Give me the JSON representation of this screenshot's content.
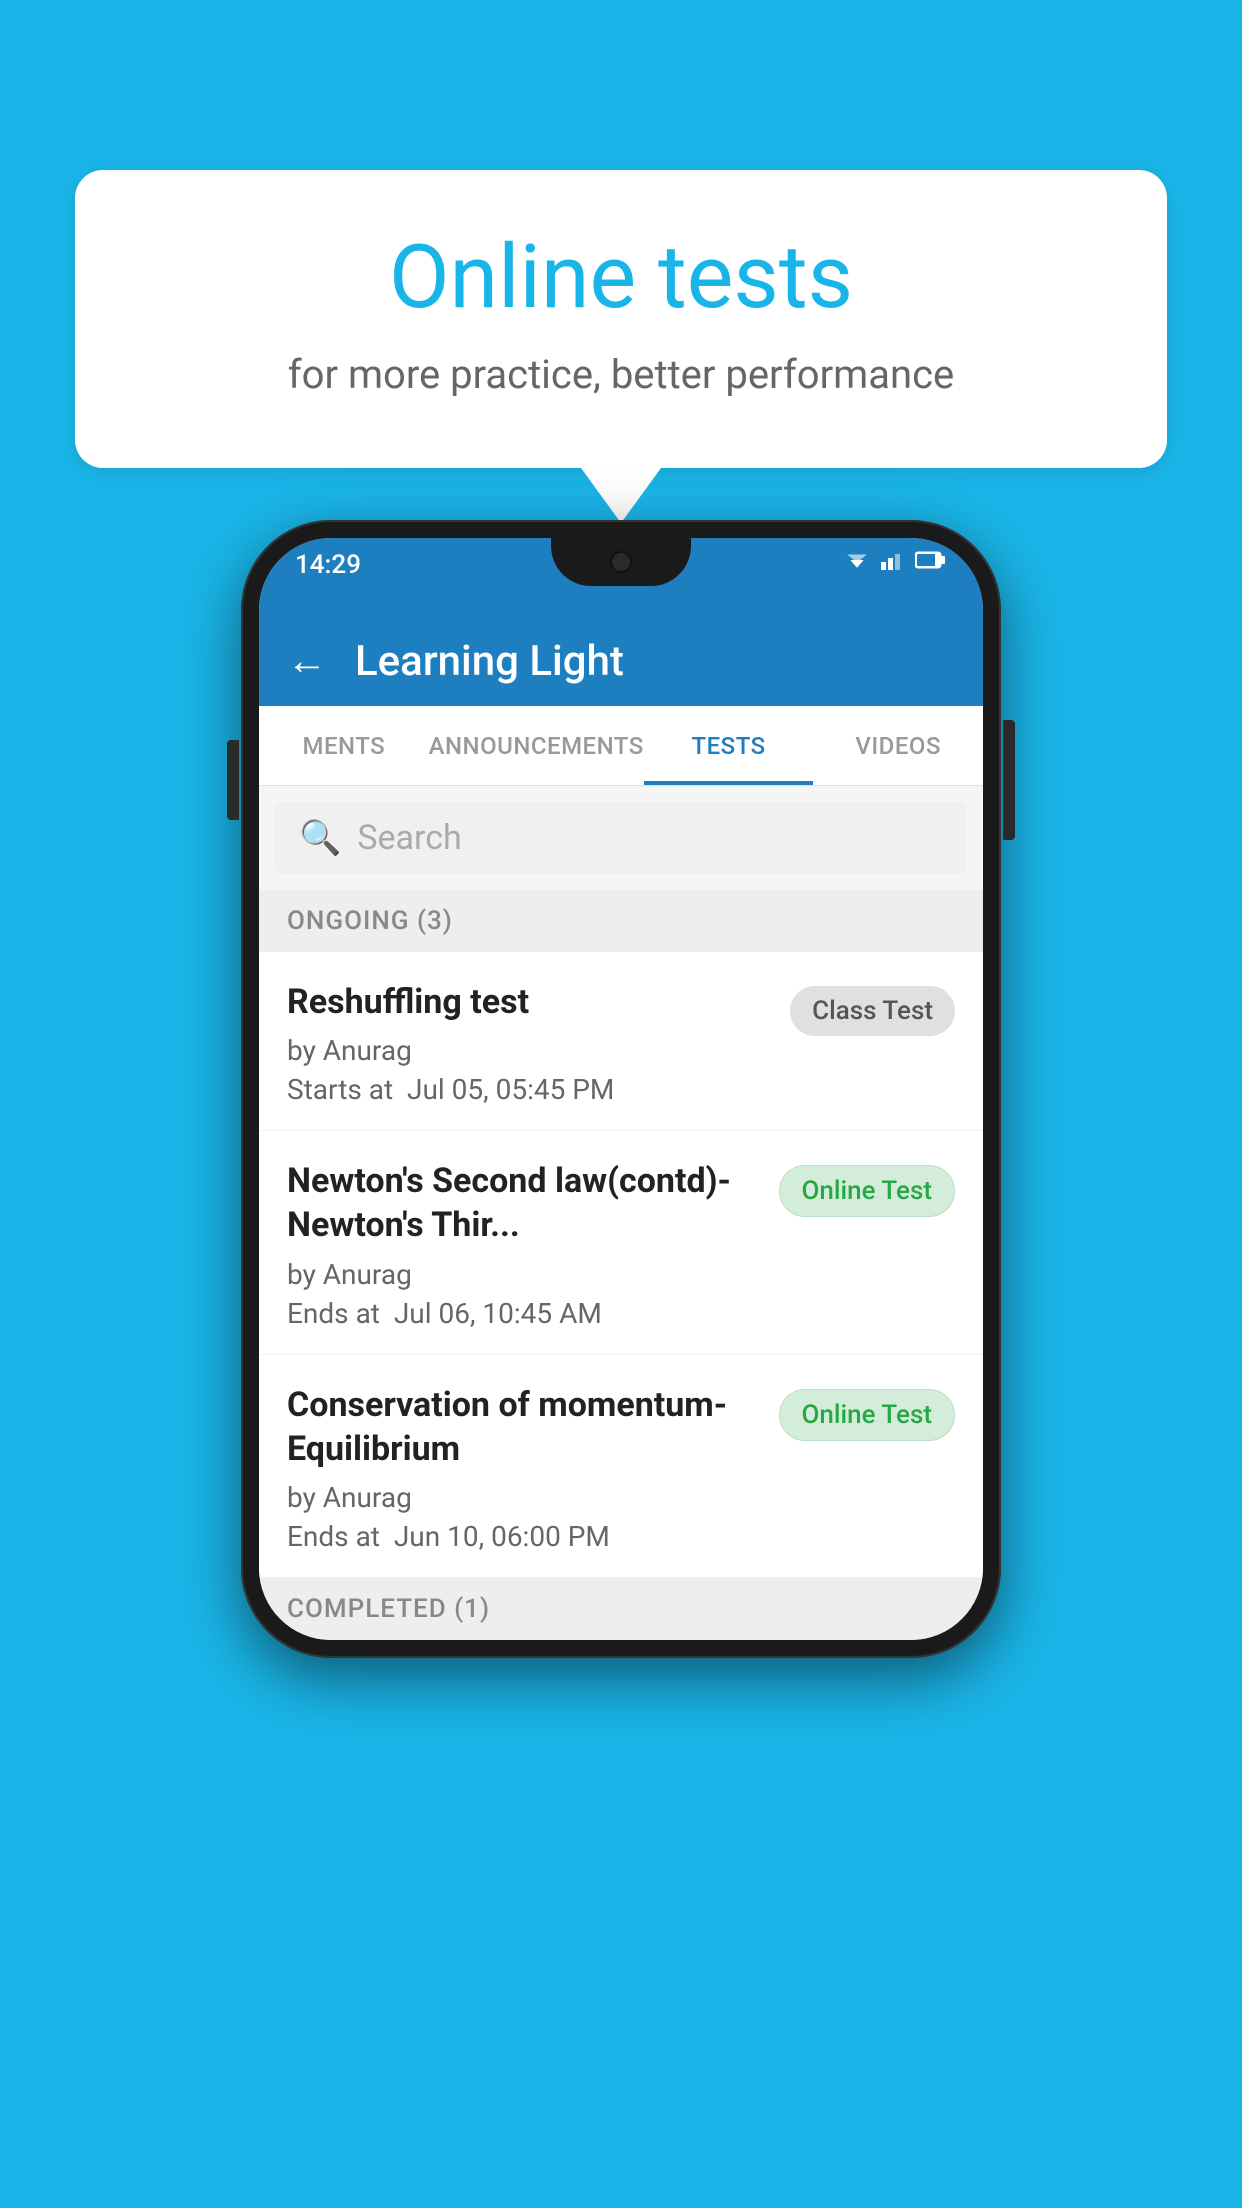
{
  "background_color": "#1ab5e8",
  "bubble": {
    "title": "Online tests",
    "subtitle": "for more practice, better performance"
  },
  "phone": {
    "status_bar": {
      "time": "14:29"
    },
    "header": {
      "title": "Learning Light",
      "back_label": "←"
    },
    "tabs": [
      {
        "label": "MENTS",
        "active": false
      },
      {
        "label": "ANNOUNCEMENTS",
        "active": false
      },
      {
        "label": "TESTS",
        "active": true
      },
      {
        "label": "VIDEOS",
        "active": false
      }
    ],
    "search": {
      "placeholder": "Search"
    },
    "ongoing_section": {
      "label": "ONGOING (3)"
    },
    "test_items": [
      {
        "name": "Reshuffling test",
        "author": "by Anurag",
        "date_label": "Starts at",
        "date": "Jul 05, 05:45 PM",
        "badge": "Class Test",
        "badge_type": "class"
      },
      {
        "name": "Newton's Second law(contd)-Newton's Thir...",
        "author": "by Anurag",
        "date_label": "Ends at",
        "date": "Jul 06, 10:45 AM",
        "badge": "Online Test",
        "badge_type": "online"
      },
      {
        "name": "Conservation of momentum-Equilibrium",
        "author": "by Anurag",
        "date_label": "Ends at",
        "date": "Jun 10, 06:00 PM",
        "badge": "Online Test",
        "badge_type": "online"
      }
    ],
    "completed_section": {
      "label": "COMPLETED (1)"
    }
  }
}
